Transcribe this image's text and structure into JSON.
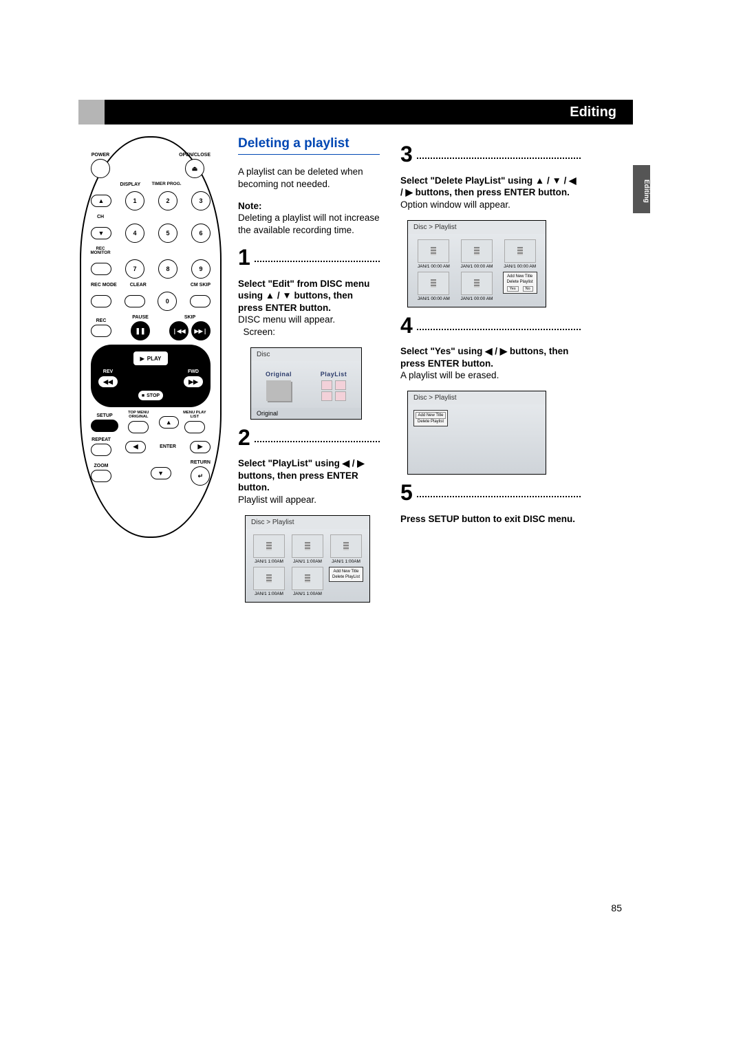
{
  "header": {
    "title": "Editing",
    "side_tab": "Editing"
  },
  "page_number": "85",
  "section": {
    "title": "Deleting a playlist",
    "intro": "A playlist can be deleted when becoming not needed.",
    "note_label": "Note:",
    "note_text": "Deleting a playlist will not increase the available recording time."
  },
  "steps": {
    "s1": {
      "num": "1",
      "bold": "Select \"Edit\" from DISC menu using ▲ / ▼ buttons, then press ENTER button.",
      "body": "DISC menu will appear.",
      "indent": "Screen:"
    },
    "s2": {
      "num": "2",
      "bold": "Select \"PlayList\" using ◀ / ▶ buttons, then press ENTER button.",
      "body": "Playlist will appear."
    },
    "s3": {
      "num": "3",
      "bold": "Select \"Delete PlayList\" using ▲ / ▼ / ◀ / ▶ buttons, then press ENTER button.",
      "body": "Option window will appear."
    },
    "s4": {
      "num": "4",
      "bold": "Select \"Yes\" using ◀ / ▶ buttons, then press ENTER button.",
      "body": "A playlist will be erased."
    },
    "s5": {
      "num": "5",
      "bold": "Press SETUP button to exit DISC menu."
    }
  },
  "screenshots": {
    "disc": {
      "breadcrumb": "Disc",
      "original_label": "Original",
      "playlist_label": "PlayList",
      "footer": "Original"
    },
    "playlist1": {
      "breadcrumb": "Disc > Playlist",
      "timestamp": "JAN/1   1:00AM",
      "opt_add": "Add  New Title",
      "opt_delete": "Delete PlayList"
    },
    "playlist2": {
      "breadcrumb": "Disc > Playlist",
      "timestamp": "JAN/1 00:00 AM",
      "opt_add": "Add  New Title",
      "opt_delete": "Delete Playlist",
      "yes": "Yes",
      "no": "No"
    },
    "playlist3": {
      "breadcrumb": "Disc > Playlist",
      "opt_add": "Add  New Title",
      "opt_delete": "Delete Playlist"
    }
  },
  "remote": {
    "power": "POWER",
    "open_close": "OPEN/CLOSE",
    "display": "DISPLAY",
    "timer_prog": "TIMER PROG.",
    "ch": "CH",
    "rec_monitor": "REC MONITOR",
    "rec_mode": "REC MODE",
    "clear": "CLEAR",
    "cm_skip": "CM SKIP",
    "rec": "REC",
    "pause": "PAUSE",
    "skip": "SKIP",
    "play": "PLAY",
    "rev": "REV",
    "fwd": "FWD",
    "stop": "STOP",
    "setup": "SETUP",
    "top_menu_original": "TOP MENU ORIGINAL",
    "menu_playlist": "MENU PLAY LIST",
    "repeat": "REPEAT",
    "enter": "ENTER",
    "zoom": "ZOOM",
    "return": "RETURN",
    "digits": [
      "1",
      "2",
      "3",
      "4",
      "5",
      "6",
      "7",
      "8",
      "9",
      "0"
    ]
  }
}
